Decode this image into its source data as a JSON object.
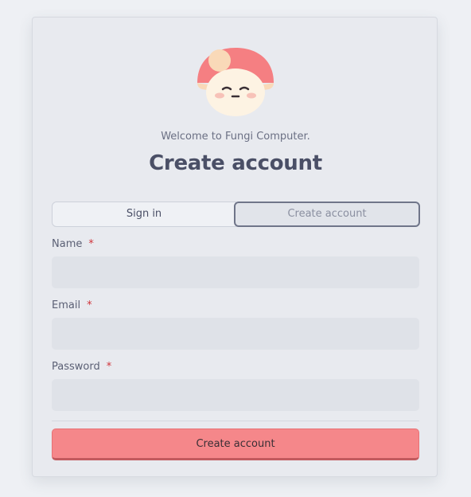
{
  "header": {
    "logo_icon": "fungi-mushroom-logo-icon",
    "welcome_text": "Welcome to Fungi Computer.",
    "title": "Create account"
  },
  "tabs": [
    {
      "label": "Sign in",
      "active": false
    },
    {
      "label": "Create account",
      "active": true
    }
  ],
  "form": {
    "required_marker": "*",
    "fields": [
      {
        "label": "Name",
        "value": "",
        "placeholder": "",
        "required": true
      },
      {
        "label": "Email",
        "value": "",
        "placeholder": "",
        "required": true
      },
      {
        "label": "Password",
        "value": "",
        "placeholder": "",
        "required": true
      }
    ],
    "submit_label": "Create account"
  },
  "colors": {
    "accent": "#f5878a",
    "background": "#eef0f4",
    "card": "#e8eaef",
    "required": "#d0343a",
    "text": "#4a4f66"
  }
}
